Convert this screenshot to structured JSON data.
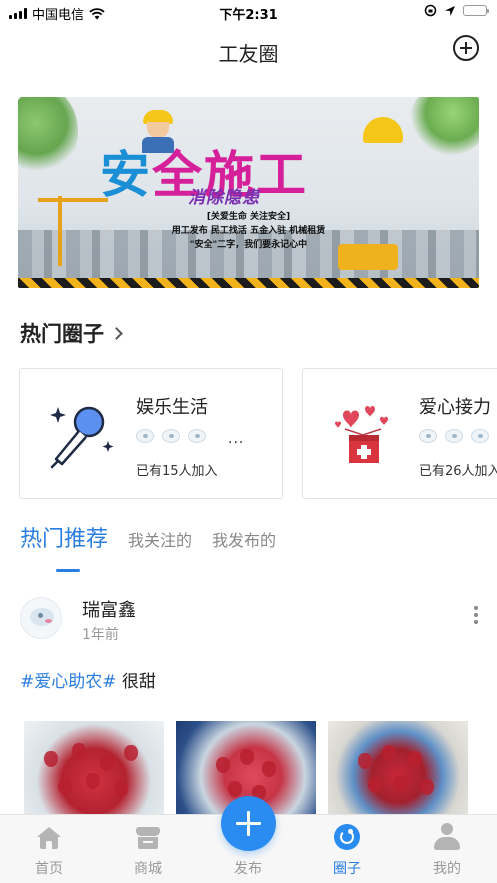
{
  "status_bar": {
    "carrier": "中国电信",
    "time": "下午2:31",
    "battery_level": 1.0
  },
  "nav": {
    "title": "工友圈",
    "add_icon": "plus-circle-icon"
  },
  "banner": {
    "headline_chars": [
      "安",
      "全",
      "施",
      "工"
    ],
    "subtitle": "消除隐患",
    "line1": "[关爱生命  关注安全]",
    "line2": "用工发布  民工找活  五金入驻  机械租赁",
    "line3": "\"安全\"二字，我们要永记心中"
  },
  "hot_circles": {
    "title": "热门圈子",
    "items": [
      {
        "name": "娱乐生活",
        "joined": "已有15人加入",
        "icon": "microphone-icon",
        "more": "..."
      },
      {
        "name": "爱心接力",
        "joined": "已有26人加入",
        "icon": "donation-box-icon"
      }
    ]
  },
  "feed_tabs": {
    "items": [
      "热门推荐",
      "我关注的",
      "我发布的"
    ],
    "active_index": 0
  },
  "post": {
    "author": "瑞富鑫",
    "time": "1年前",
    "hashtag": "#爱心助农#",
    "text": " 很甜"
  },
  "tabbar": {
    "items": [
      {
        "label": "首页",
        "icon": "home-icon"
      },
      {
        "label": "商城",
        "icon": "shop-icon"
      },
      {
        "label": "发布",
        "icon": "plus-icon"
      },
      {
        "label": "圈子",
        "icon": "circle-refresh-icon"
      },
      {
        "label": "我的",
        "icon": "person-icon"
      }
    ],
    "active_index": 3
  },
  "colors": {
    "accent": "#2a7de1",
    "fab": "#2a8cf0"
  }
}
